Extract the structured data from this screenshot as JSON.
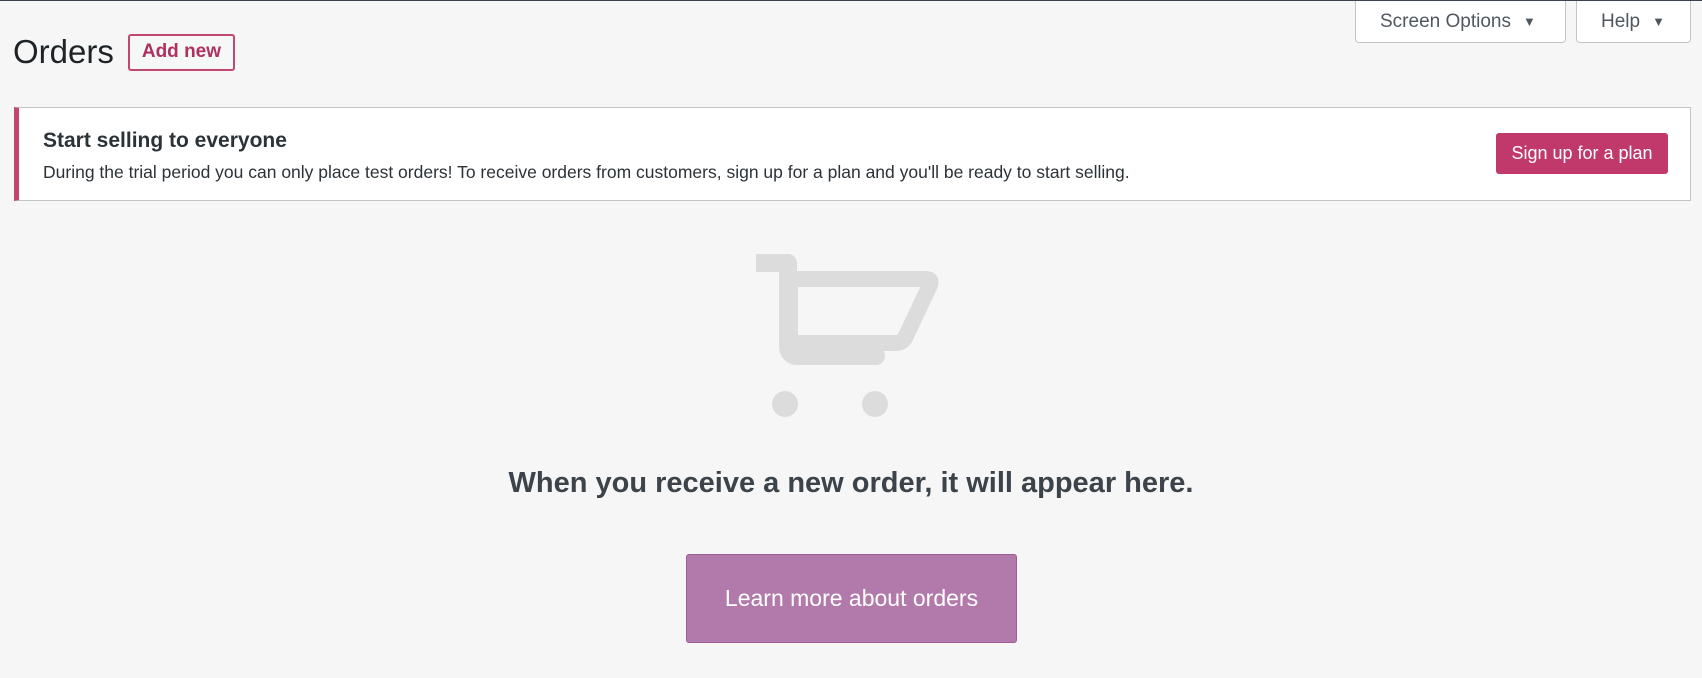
{
  "screen_meta": {
    "screen_options_label": "Screen Options",
    "help_label": "Help",
    "caret_icon": "caret-down-icon"
  },
  "header": {
    "title": "Orders",
    "add_new_label": "Add new"
  },
  "notice": {
    "title": "Start selling to everyone",
    "text": "During the trial period you can only place test orders! To receive orders from customers, sign up for a plan and you'll be ready to start selling.",
    "button_label": "Sign up for a plan",
    "accent_color": "#c0476e"
  },
  "empty_state": {
    "icon": "shopping-cart-icon",
    "message": "When you receive a new order, it will appear here.",
    "button_label": "Learn more about orders",
    "button_color": "#b27aab"
  }
}
